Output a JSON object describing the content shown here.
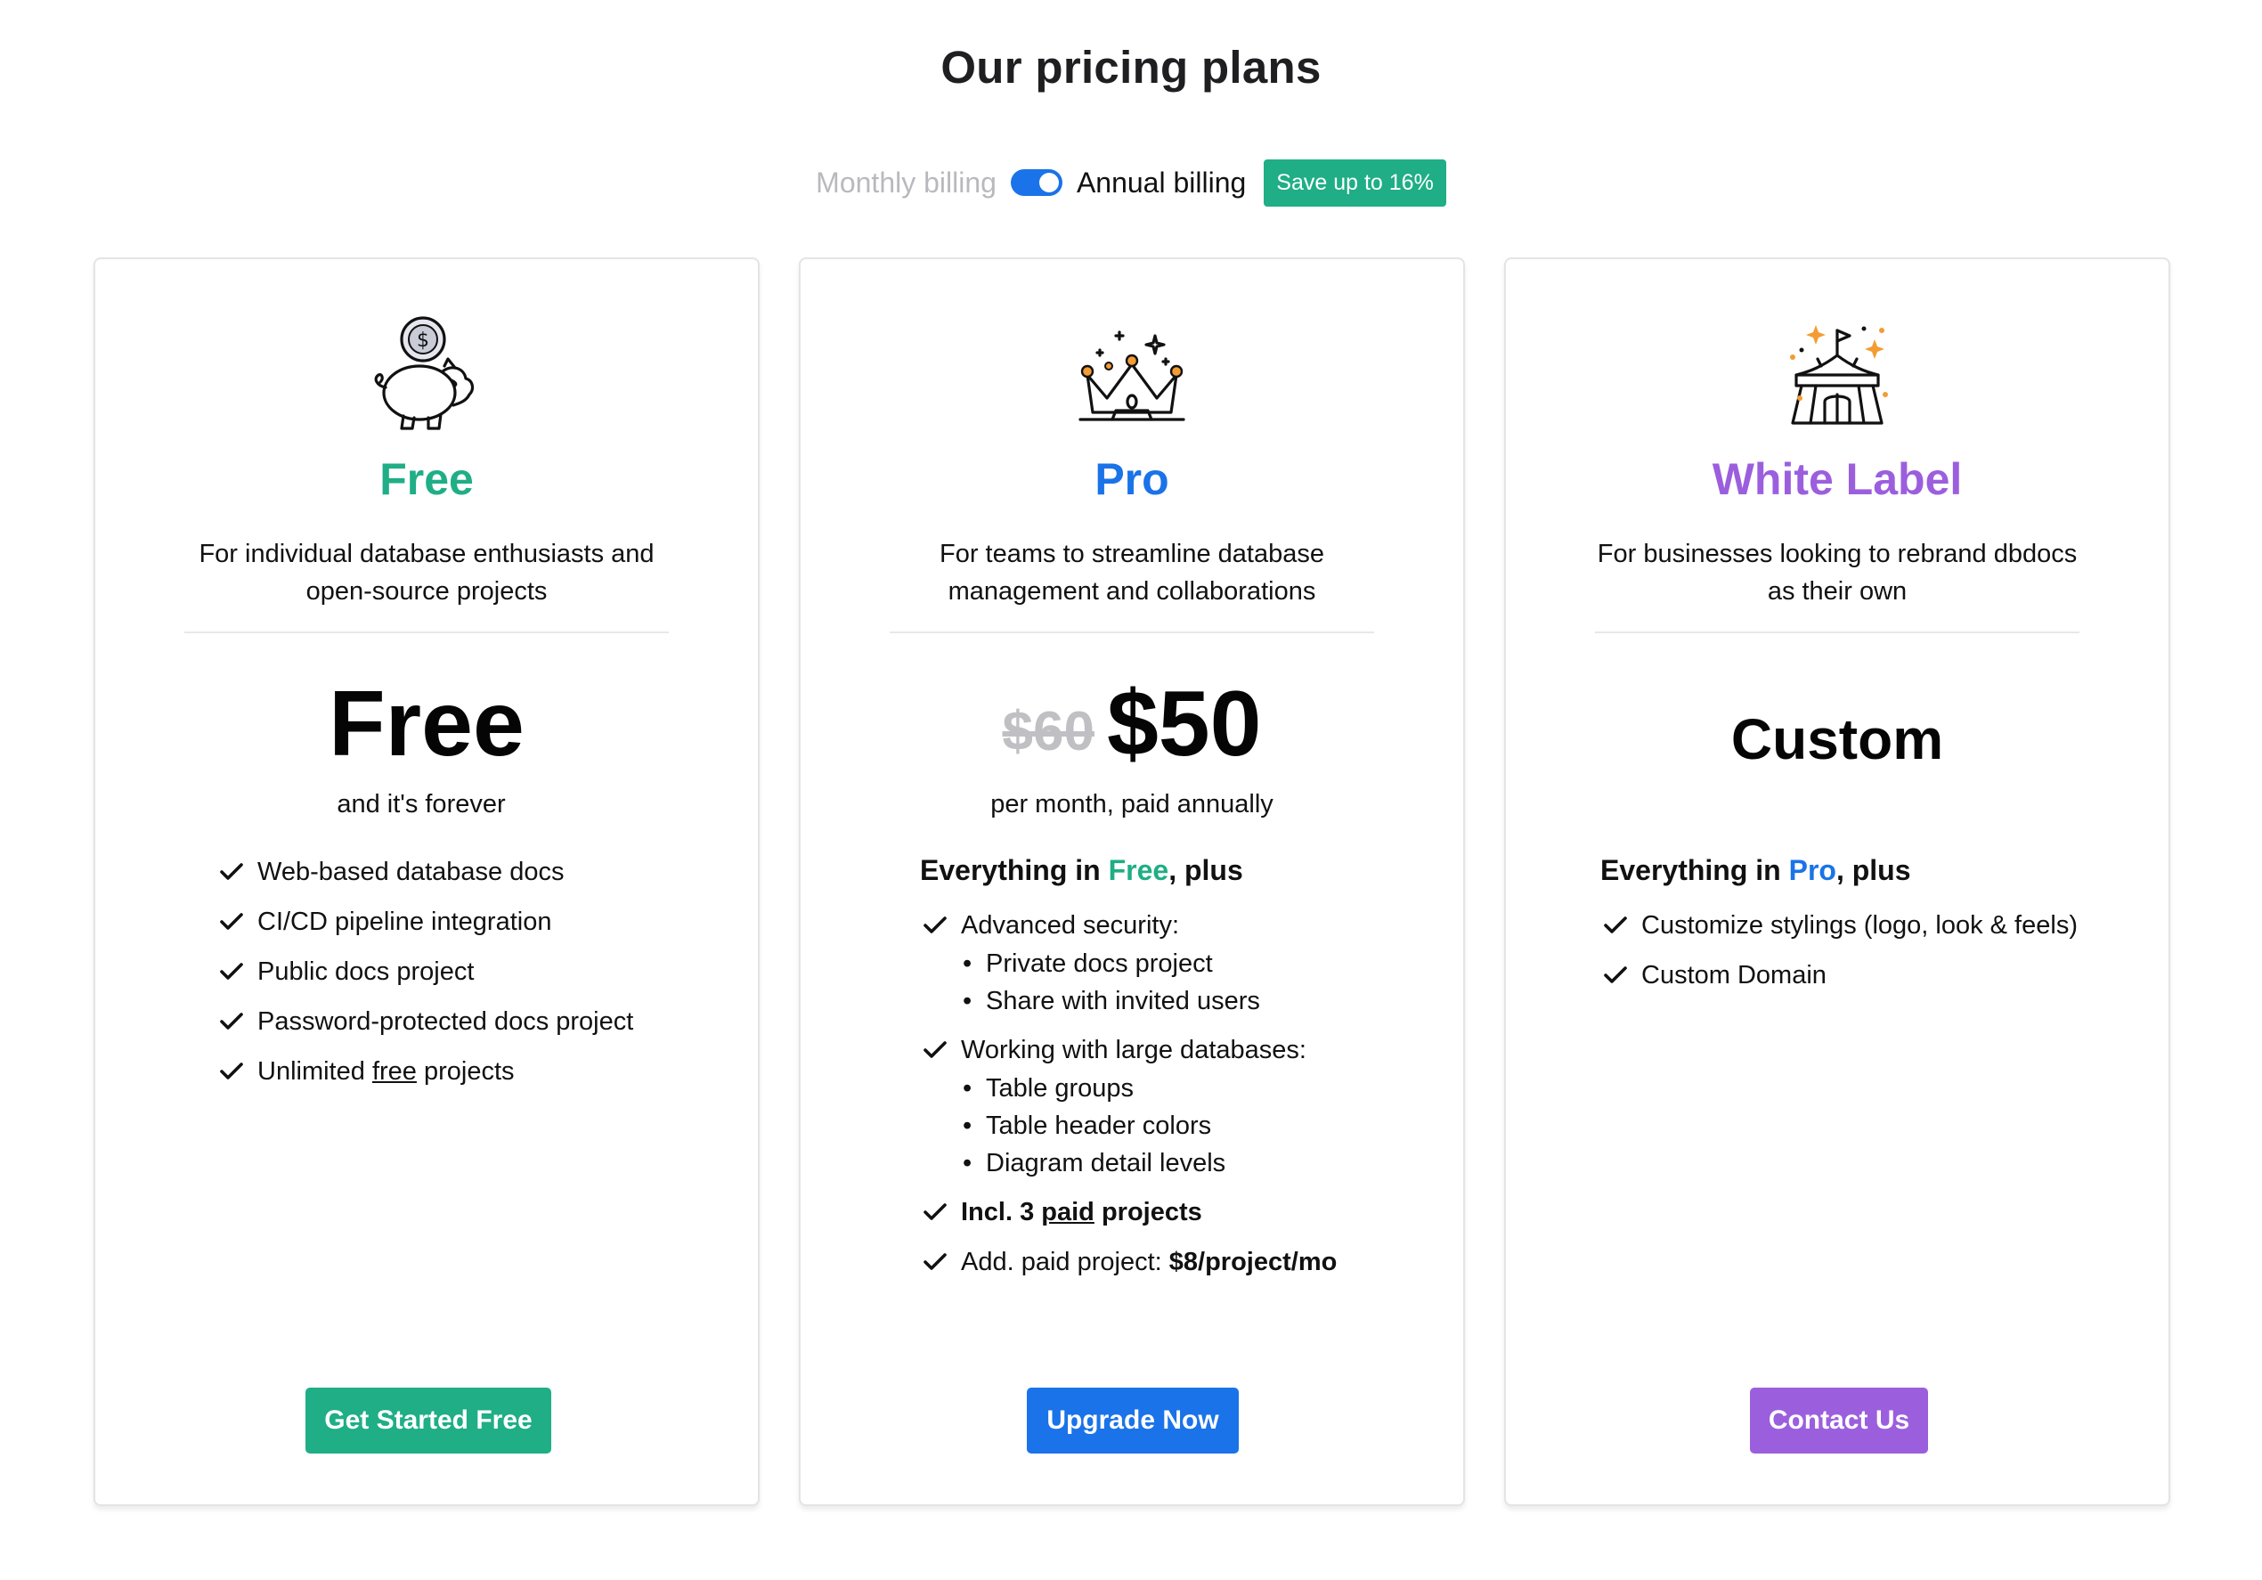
{
  "page": {
    "title": "Our pricing plans"
  },
  "billing": {
    "monthly_label": "Monthly billing",
    "annual_label": "Annual billing",
    "selected": "annual",
    "save_badge": "Save up to 16%"
  },
  "colors": {
    "free": "#1fae86",
    "pro": "#1a73e8",
    "white_label": "#9b5fde",
    "toggle": "#1a73e8"
  },
  "plans": [
    {
      "name": "Free",
      "icon": "piggy-bank-icon",
      "description": "For individual database enthusiasts and open-source projects",
      "price": "Free",
      "price_note": "and it's forever",
      "features": [
        {
          "text": "Web-based database docs"
        },
        {
          "text": "CI/CD pipeline integration"
        },
        {
          "text": "Public docs project"
        },
        {
          "text": "Password-protected docs project"
        },
        {
          "text_before": "Unlimited ",
          "text_underline": "free",
          "text_after": " projects"
        }
      ],
      "cta": "Get Started Free"
    },
    {
      "name": "Pro",
      "icon": "crown-icon",
      "description": "For teams to streamline database management and collaborations",
      "old_price": "$60",
      "price": "$50",
      "price_note": "per month, paid annually",
      "includes_head": {
        "prefix": "Everything in ",
        "plan": "Free",
        "suffix": ", plus"
      },
      "features": [
        {
          "text": "Advanced security:",
          "sub": [
            "Private docs project",
            "Share with invited users"
          ]
        },
        {
          "text": "Working with large databases:",
          "sub": [
            "Table groups",
            "Table header colors",
            "Diagram detail levels"
          ]
        },
        {
          "bold_before": "Incl. 3 ",
          "bold_underline": "paid",
          "bold_after": " projects"
        },
        {
          "text": "Add. paid project: ",
          "bold_suffix": "$8/project/mo"
        }
      ],
      "cta": "Upgrade Now"
    },
    {
      "name": "White Label",
      "icon": "circus-tent-icon",
      "description": "For businesses looking to rebrand dbdocs as their own",
      "price": "Custom",
      "includes_head": {
        "prefix": "Everything in ",
        "plan": "Pro",
        "suffix": ", plus"
      },
      "features": [
        {
          "text": "Customize stylings (logo, look & feels)"
        },
        {
          "text": "Custom Domain"
        }
      ],
      "cta": "Contact Us"
    }
  ]
}
